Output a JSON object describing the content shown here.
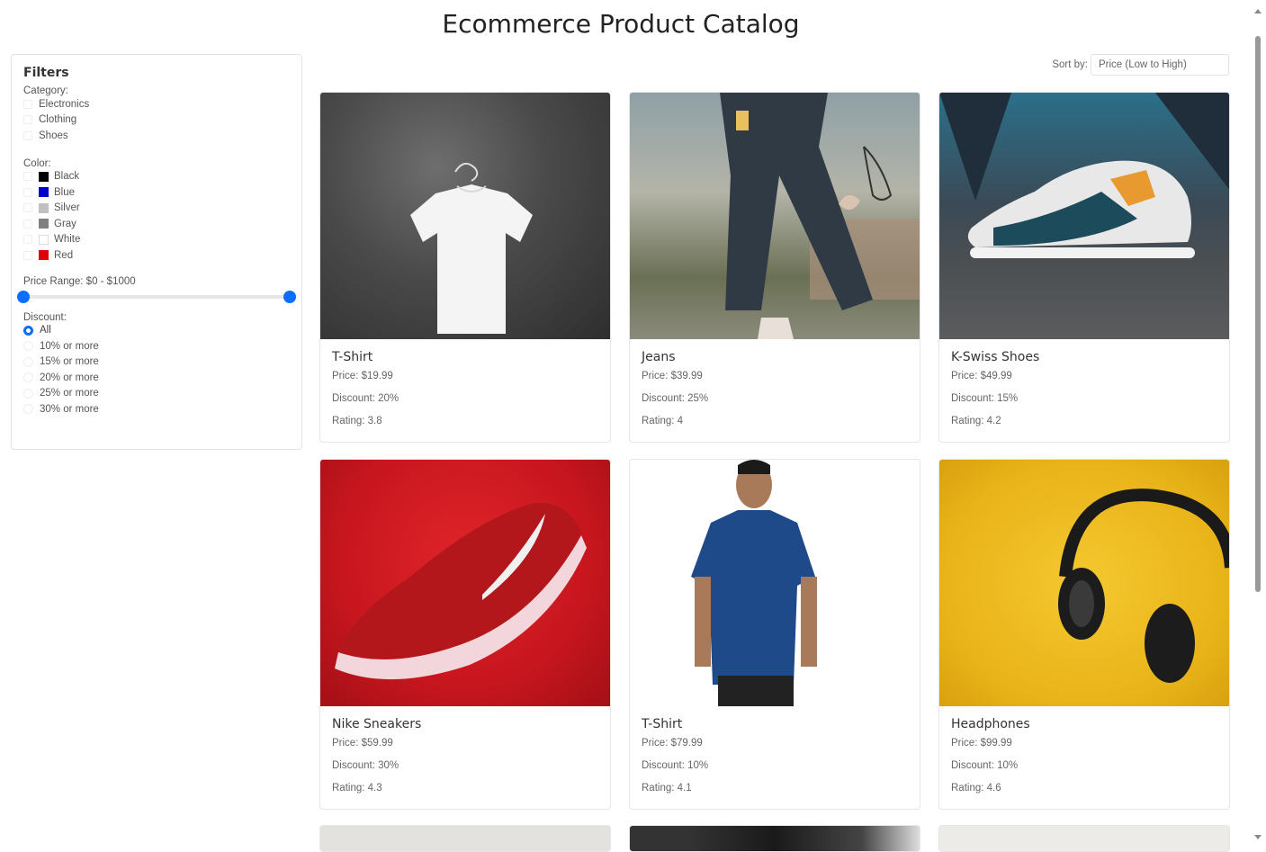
{
  "title": "Ecommerce Product Catalog",
  "filters": {
    "heading": "Filters",
    "category_label": "Category:",
    "categories": [
      "Electronics",
      "Clothing",
      "Shoes"
    ],
    "color_label": "Color:",
    "colors": [
      {
        "name": "Black",
        "hex": "#000000"
      },
      {
        "name": "Blue",
        "hex": "#0000cc"
      },
      {
        "name": "Silver",
        "hex": "#c0c0c0"
      },
      {
        "name": "Gray",
        "hex": "#808080"
      },
      {
        "name": "White",
        "hex": "#ffffff"
      },
      {
        "name": "Red",
        "hex": "#e00000"
      }
    ],
    "price_label": "Price Range: $0 - $1000",
    "discount_label": "Discount:",
    "discounts": [
      "All",
      "10% or more",
      "15% or more",
      "20% or more",
      "25% or more",
      "30% or more"
    ]
  },
  "sort": {
    "label": "Sort by:",
    "selected": "Price (Low to High)"
  },
  "products": [
    {
      "name": "T-Shirt",
      "price": "Price: $19.99",
      "discount": "Discount: 20%",
      "rating": "Rating: 3.8",
      "image": "white-tshirt-on-hanger"
    },
    {
      "name": "Jeans",
      "price": "Price: $39.99",
      "discount": "Discount: 25%",
      "rating": "Rating: 4",
      "image": "ripped-jeans"
    },
    {
      "name": "K-Swiss Shoes",
      "price": "Price: $49.99",
      "discount": "Discount: 15%",
      "rating": "Rating: 4.2",
      "image": "sneaker-on-street"
    },
    {
      "name": "Nike Sneakers",
      "price": "Price: $59.99",
      "discount": "Discount: 30%",
      "rating": "Rating: 4.3",
      "image": "red-nike-sneaker"
    },
    {
      "name": "T-Shirt",
      "price": "Price: $79.99",
      "discount": "Discount: 10%",
      "rating": "Rating: 4.1",
      "image": "blue-polo-model"
    },
    {
      "name": "Headphones",
      "price": "Price: $99.99",
      "discount": "Discount: 10%",
      "rating": "Rating: 4.6",
      "image": "black-headphones-yellow"
    }
  ]
}
